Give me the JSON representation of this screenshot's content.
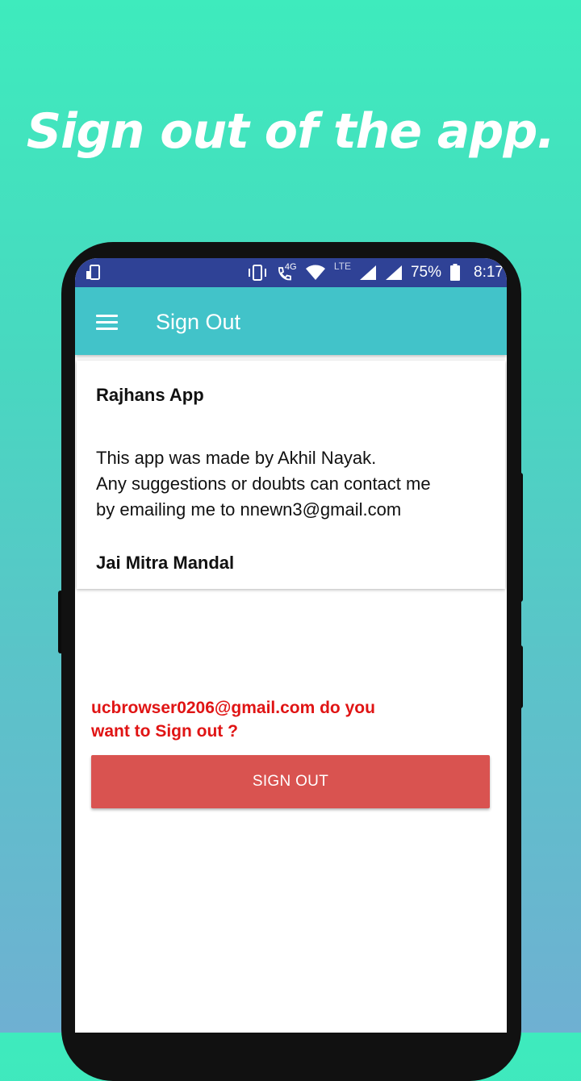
{
  "headline": "Sign out of the app.",
  "status_bar": {
    "network_label": "4G",
    "lte_label": "LTE",
    "battery_percent": "75%",
    "time": "8:17",
    "icons": [
      "screenshot-icon",
      "vibrate-icon",
      "volte-call-icon",
      "wifi-icon",
      "signal-icon",
      "signal-icon",
      "battery-icon"
    ]
  },
  "app_bar": {
    "title": "Sign Out",
    "menu_icon": "hamburger-menu-icon"
  },
  "info_card": {
    "title": "Rajhans App",
    "body_lines": [
      "This app was made by Akhil Nayak.",
      "Any suggestions or doubts can contact me",
      "by emailing me to nnewn3@gmail.com"
    ],
    "footer": "Jai Mitra Mandal"
  },
  "prompt": {
    "line1": "ucbrowser0206@gmail.com do you",
    "line2": "want to Sign out ?"
  },
  "sign_out_button": {
    "label": "SIGN OUT"
  },
  "colors": {
    "status_bar": "#2f4296",
    "app_bar": "#42c3c9",
    "prompt_text": "#e01414",
    "button": "#d95350"
  }
}
